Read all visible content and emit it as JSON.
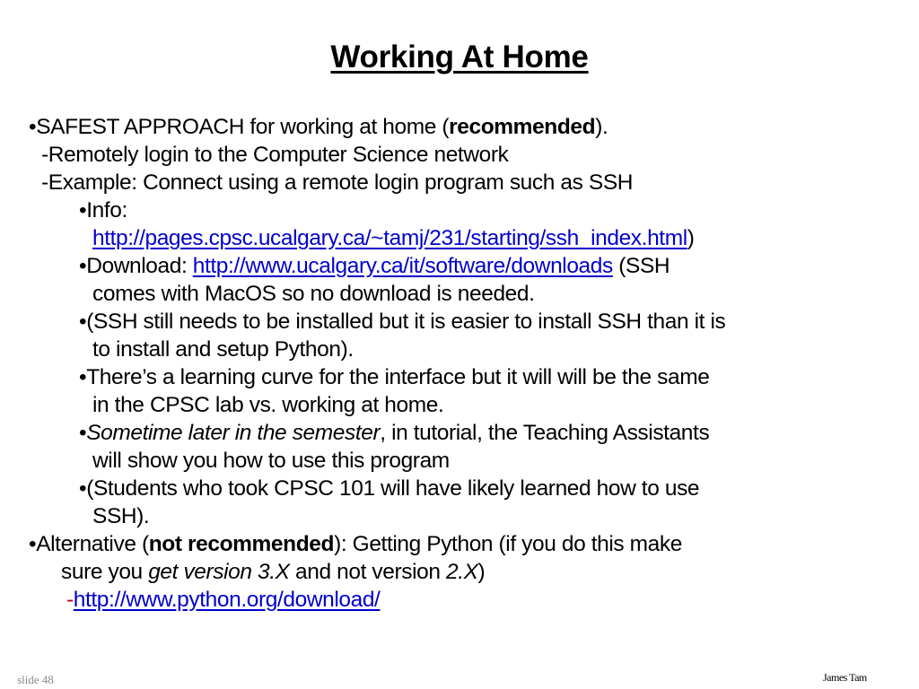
{
  "slide": {
    "title": "Working At Home",
    "lines": [
      {
        "bullet": "•",
        "pre": "SAFEST APPROACH for working at home (",
        "bold": "recommended",
        "post": ")."
      },
      {
        "dash": "-",
        "text": "Remotely login to the Computer Science network"
      },
      {
        "dash": "-",
        "text": "Example: Connect using a remote login program such as SSH"
      },
      {
        "bullet": "•",
        "text": "Info:"
      },
      {
        "link": "http://pages.cpsc.ucalgary.ca/~tamj/231/starting/ssh_index.html",
        "post": ")"
      },
      {
        "bullet": "•",
        "pre": "Download: ",
        "link": "http://www.ucalgary.ca/it/software/downloads",
        "post": " (SSH"
      },
      {
        "text": "comes with MacOS so no download is needed."
      },
      {
        "bullet": "•",
        "text": "(SSH still needs to be installed but it is easier to install SSH than it is"
      },
      {
        "text": "to install and setup Python)."
      },
      {
        "bullet": "•",
        "text": "There’s a learning curve for the interface but it will will be the same"
      },
      {
        "text": "in the CPSC lab vs. working at home."
      },
      {
        "bullet": "•",
        "italic": "Sometime later in the semester",
        "post": ", in tutorial, the Teaching Assistants"
      },
      {
        "text": "will show you how to use this program"
      },
      {
        "bullet": "•",
        "text": "(Students who took CPSC 101 will have likely learned how to use"
      },
      {
        "text": "SSH)."
      },
      {
        "bullet": "•",
        "pre": "Alternative (",
        "bold": "not recommended",
        "post": "): Getting Python (if you do this make"
      },
      {
        "pre": "sure you ",
        "italic": "get version 3.X",
        "mid": " and not version ",
        "italic2": "2.X",
        "post": ")"
      },
      {
        "dash": "-",
        "link": "http://www.python.org/download/"
      }
    ]
  },
  "footer": {
    "slide_number": "slide 48",
    "author": "James Tam"
  },
  "colors": {
    "link": "#0000cc",
    "red_dash": "#c00020"
  }
}
